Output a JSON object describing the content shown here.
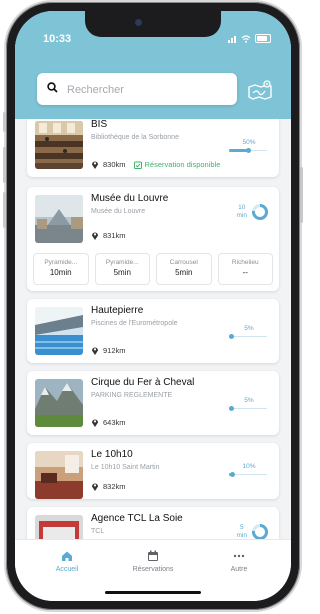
{
  "status_bar": {
    "time": "10:33"
  },
  "search": {
    "placeholder": "Rechercher"
  },
  "places": [
    {
      "title": "BIS",
      "subtitle": "Bibliothèque de la Sorbonne",
      "distance": "830km",
      "reservation": "Réservation disponible",
      "occupancy_label": "50%",
      "occupancy": 0.5
    },
    {
      "title": "Musée du Louvre",
      "subtitle": "Musée du Louvre",
      "distance": "831km",
      "wait_value": "10",
      "wait_unit": "min",
      "metro": [
        {
          "name": "Pyramide...",
          "time": "10min"
        },
        {
          "name": "Pyramide...",
          "time": "5min"
        },
        {
          "name": "Carrousel",
          "time": "5min"
        },
        {
          "name": "Richelieu",
          "time": "--"
        }
      ]
    },
    {
      "title": "Hautepierre",
      "subtitle": "Piscines de l'Eurométropole",
      "distance": "912km",
      "occupancy_label": "5%",
      "occupancy": 0.05
    },
    {
      "title": "Cirque du Fer à Cheval",
      "subtitle": "PARKING REGLEMENTE",
      "distance": "643km",
      "occupancy_label": "5%",
      "occupancy": 0.05
    },
    {
      "title": "Le 10h10",
      "subtitle": "Le 10h10 Saint Martin",
      "distance": "832km",
      "occupancy_label": "10%",
      "occupancy": 0.1
    },
    {
      "title": "Agence TCL La Soie",
      "subtitle": "TCL",
      "wait_value": "5",
      "wait_unit": "min"
    }
  ],
  "tabs": [
    {
      "label": "Accueil",
      "icon": "home-icon",
      "active": true
    },
    {
      "label": "Réservations",
      "icon": "calendar-icon",
      "active": false
    },
    {
      "label": "Autre",
      "icon": "more-icon",
      "active": false
    }
  ],
  "colors": {
    "header": "#7ec3d6",
    "accent": "#5aaad2",
    "available": "#3fb26c"
  }
}
